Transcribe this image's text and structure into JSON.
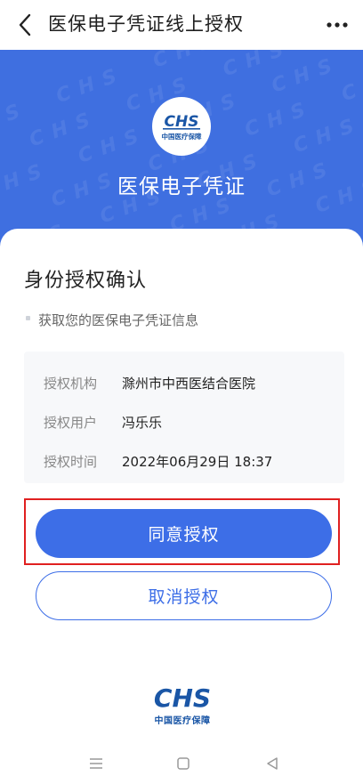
{
  "topbar": {
    "title": "医保电子凭证线上授权",
    "back_icon": "chevron-left-icon",
    "more_icon": "more-dots-icon"
  },
  "hero": {
    "logo_brand": "CHS",
    "logo_caption": "中国医疗保障",
    "title": "医保电子凭证",
    "background_color": "#3f6fe0"
  },
  "card": {
    "title": "身份授权确认",
    "description": "获取您的医保电子凭证信息",
    "info_rows": [
      {
        "label": "授权机构",
        "value": "滁州市中西医结合医院"
      },
      {
        "label": "授权用户",
        "value": "冯乐乐"
      },
      {
        "label": "授权时间",
        "value": "2022年06月29日 18:37"
      }
    ]
  },
  "actions": {
    "agree_label": "同意授权",
    "cancel_label": "取消授权",
    "accent_color": "#3d6ee7",
    "highlight_color": "#e02020"
  },
  "footer": {
    "logo_brand": "CHS",
    "logo_caption": "中国医疗保障"
  },
  "navbar": {
    "menu_icon": "menu-lines-icon",
    "home_icon": "home-square-icon",
    "back_icon": "back-triangle-icon"
  }
}
